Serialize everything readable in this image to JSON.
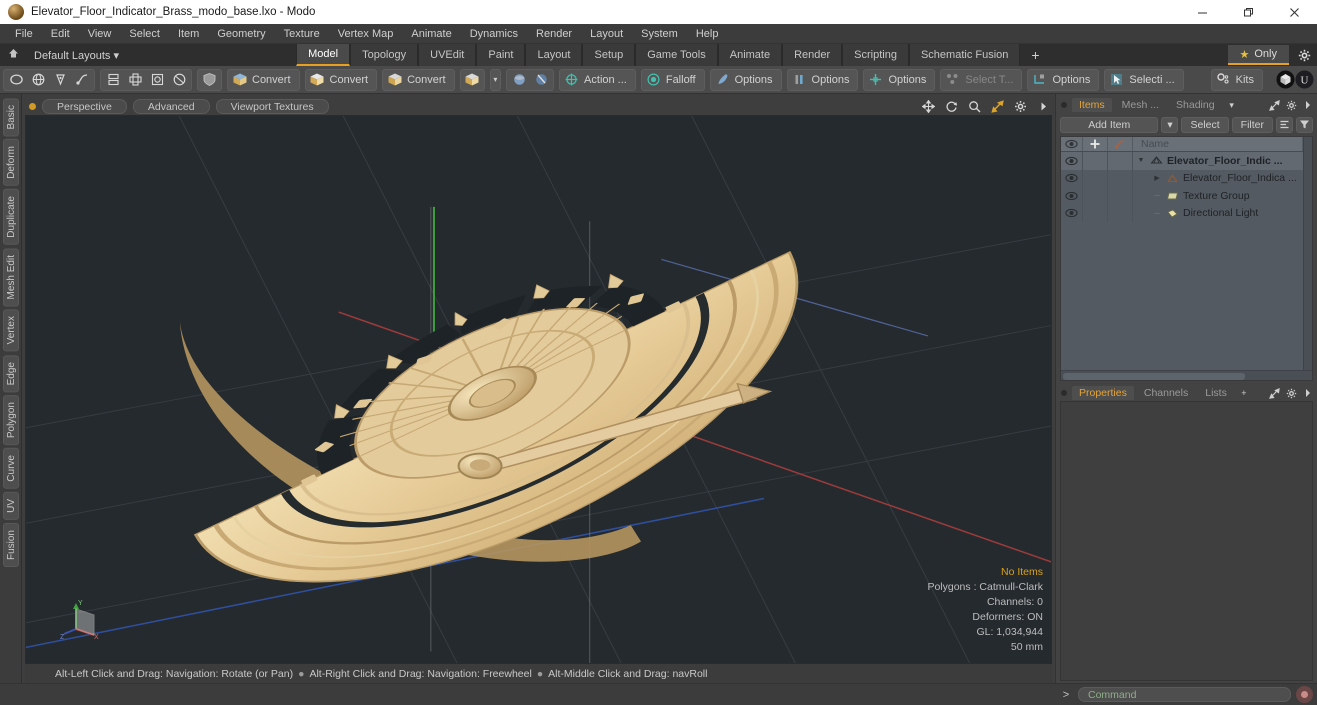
{
  "window": {
    "title": "Elevator_Floor_Indicator_Brass_modo_base.lxo - Modo",
    "app_icon": "modo-icon",
    "minimize": "minimize-icon",
    "maximize": "restore-icon",
    "close": "close-icon"
  },
  "menubar": {
    "items": [
      "File",
      "Edit",
      "View",
      "Select",
      "Item",
      "Geometry",
      "Texture",
      "Vertex Map",
      "Animate",
      "Dynamics",
      "Render",
      "Layout",
      "System",
      "Help"
    ]
  },
  "layoutbar": {
    "home_icon": "home-icon",
    "layouts_label": "Default Layouts ▾",
    "tabs": [
      "Model",
      "Topology",
      "UVEdit",
      "Paint",
      "Layout",
      "Setup",
      "Game Tools",
      "Animate",
      "Render",
      "Scripting",
      "Schematic Fusion"
    ],
    "active_tab": "Model",
    "add_tab": "+",
    "only_label": "Only",
    "only_star": "star-icon",
    "gear": "gear-icon"
  },
  "toolbar": {
    "shape_icons": [
      "circle-icon",
      "globe-icon",
      "pen-icon",
      "curve-icon"
    ],
    "mode_icons": [
      "mirror-icon",
      "array-icon",
      "radial-icon",
      "bevel-icon"
    ],
    "shield_icon": "shield-icon",
    "convert_buttons": [
      "Convert",
      "Convert",
      "Convert"
    ],
    "cube_icon": "cube-icon",
    "dropdown": "▾",
    "sphere_icons": [
      "sphere-blue-icon",
      "sphere-dark-icon"
    ],
    "action_label": "Action  ...",
    "falloff_label": "Falloff",
    "options_1": "Options",
    "options_2": "Options",
    "options_3": "Options",
    "select_through_label": "Select T...",
    "options_4": "Options",
    "selection_label": "Selecti ...",
    "kits_label": "Kits",
    "right_icons": [
      "modo-badge-icon",
      "unreal-badge-icon"
    ]
  },
  "vertical_tabs": {
    "items": [
      "Basic",
      "Deform",
      "Duplicate",
      "Mesh Edit",
      "Vertex",
      "Edge",
      "Polygon",
      "Curve",
      "UV",
      "Fusion"
    ]
  },
  "viewport": {
    "pills": [
      "Perspective",
      "Advanced",
      "Viewport Textures"
    ],
    "controls": [
      "pan-icon",
      "rotate-icon",
      "zoom-icon",
      "fit-icon",
      "gear-icon",
      "chevron-right-icon"
    ],
    "stats": {
      "no_items": "No Items",
      "polygons": "Polygons : Catmull-Clark",
      "channels": "Channels: 0",
      "deformers": "Deformers: ON",
      "gl": "GL: 1,034,944",
      "scale": "50 mm"
    },
    "axis_gizmo": "axis-gizmo",
    "model_description": "Brass elevator floor indicator semicircular dial"
  },
  "viewport_status": {
    "hint_1": "Alt-Left Click and Drag: Navigation: Rotate (or Pan)",
    "hint_2": "Alt-Right Click and Drag: Navigation: Freewheel",
    "hint_3": "Alt-Middle Click and Drag: navRoll",
    "separator": "●"
  },
  "right_panel": {
    "tabs": [
      {
        "label": "Items",
        "active": true
      },
      {
        "label": "Mesh ...",
        "active": false
      },
      {
        "label": "Shading",
        "active": false
      }
    ],
    "tab_dropdown": "▾",
    "expand_icon": "expand-icon",
    "gear_icon": "gear-icon",
    "more_icon": "chevron-right-icon",
    "controls": {
      "add_item": "Add Item",
      "add_item_dropdown": "▾",
      "select": "Select",
      "filter": "Filter",
      "list_icon": "list-icon",
      "funnel_icon": "funnel-icon"
    },
    "list": {
      "columns": [
        "eye-icon",
        "plus-icon",
        "deform-icon",
        "Name"
      ],
      "rows": [
        {
          "name": "Elevator_Floor_Indic ...",
          "icon": "mesh-icon",
          "depth": 0,
          "expanded": true,
          "bold": true,
          "selected": true
        },
        {
          "name": "Elevator_Floor_Indica ...",
          "icon": "mesh-layer-icon",
          "depth": 1,
          "expanded": false,
          "bold": false,
          "selected": false
        },
        {
          "name": "Texture Group",
          "icon": "texture-group-icon",
          "depth": 1,
          "expanded": null,
          "bold": false,
          "selected": false
        },
        {
          "name": "Directional Light",
          "icon": "light-icon",
          "depth": 1,
          "expanded": null,
          "bold": false,
          "selected": false
        }
      ]
    },
    "lower_tabs": [
      {
        "label": "Properties",
        "active": true
      },
      {
        "label": "Channels",
        "active": false
      },
      {
        "label": "Lists",
        "active": false
      }
    ],
    "lower_add": "+",
    "lower_expand": "expand-icon",
    "lower_gear": "gear-icon",
    "lower_more": "chevron-right-icon"
  },
  "command_bar": {
    "caret": ">",
    "placeholder": "Command",
    "value": "",
    "record_icon": "record-icon"
  },
  "colors": {
    "accent_orange": "#e8a020",
    "panel_bg": "#434343",
    "viewport_bg": "#252a2e",
    "list_bg": "#545a61",
    "brass": "#e8cf9e"
  }
}
